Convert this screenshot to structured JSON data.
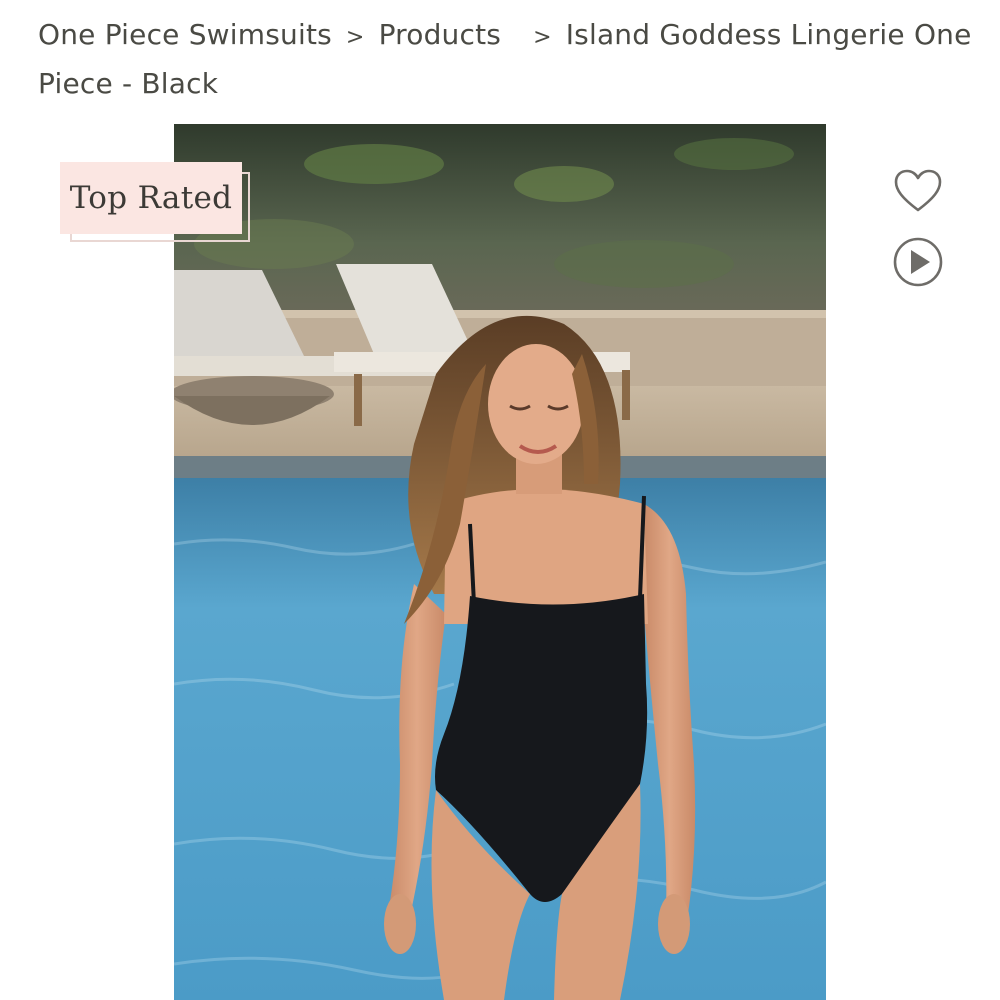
{
  "breadcrumb": {
    "items": [
      {
        "label": "One Piece Swimsuits"
      },
      {
        "label": "Products"
      },
      {
        "label": "Island Goddess Lingerie One Piece - Black"
      }
    ],
    "separator": ">"
  },
  "product": {
    "badge": "Top Rated",
    "image": "Model wearing black one piece swimsuit by a pool"
  },
  "icons": {
    "wishlist": "heart-icon",
    "video": "play-circle-icon"
  },
  "colors": {
    "badge_bg": "#fbe6e2",
    "text": "#4a4a44",
    "icon": "#6e6c68"
  }
}
